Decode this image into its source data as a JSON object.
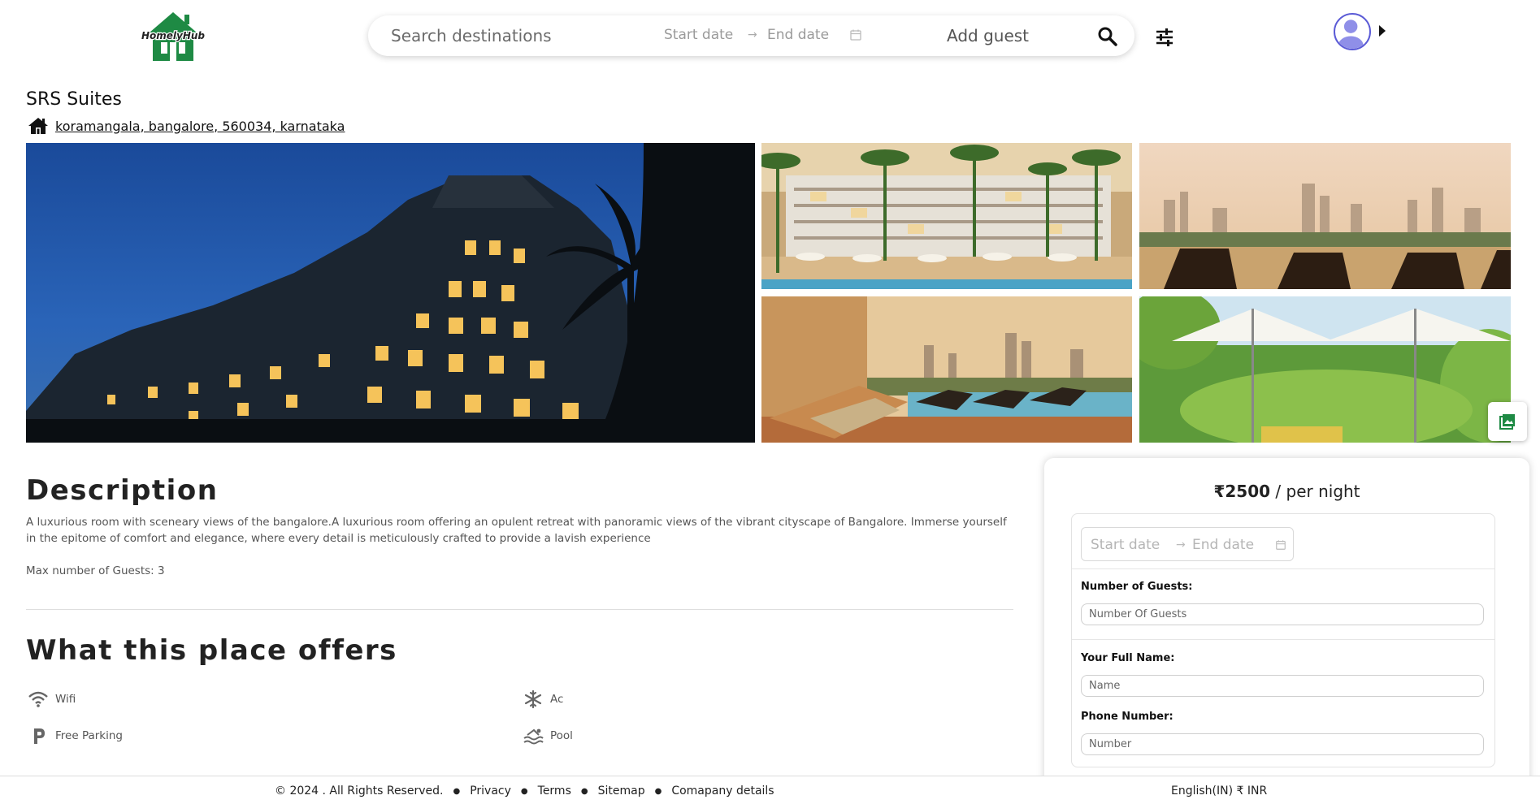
{
  "header": {
    "logo_text": "HomelyHub",
    "search": {
      "destination_placeholder": "Search destinations",
      "start_date_placeholder": "Start date",
      "end_date_placeholder": "End date",
      "guest_placeholder": "Add guest"
    },
    "colors": {
      "logo_green": "#1e8a44",
      "avatar_purple": "#8f8fe8"
    }
  },
  "property": {
    "title": "SRS Suites",
    "address": "koramangala, bangalore, 560034, karnataka"
  },
  "gallery": {
    "images": [
      "hotel-night-exterior",
      "resort-pool-palms",
      "rooftop-loungers-skyline",
      "poolside-deckchair-skyline",
      "garden-umbrellas"
    ],
    "view_all_icon": "gallery-icon"
  },
  "description": {
    "heading": "Description",
    "text": "A luxurious room with sceneary views of the bangalore.A luxurious room offering an opulent retreat with panoramic views of the vibrant cityscape of Bangalore. Immerse yourself in the epitome of comfort and elegance, where every detail is meticulously crafted to provide a lavish experience",
    "max_guests": "Max number of Guests: 3"
  },
  "offers": {
    "heading": "What this place offers",
    "amenities": [
      {
        "label": "Wifi",
        "icon": "wifi-icon"
      },
      {
        "label": "Ac",
        "icon": "snowflake-icon"
      },
      {
        "label": "Free Parking",
        "icon": "parking-icon"
      },
      {
        "label": "Pool",
        "icon": "pool-icon"
      }
    ]
  },
  "booking": {
    "price": "₹2500",
    "per_night": " / per night",
    "start_date_placeholder": "Start date",
    "end_date_placeholder": "End date",
    "guests_label": "Number of Guests:",
    "guests_placeholder": "Number Of Guests",
    "name_label": "Your Full Name:",
    "name_placeholder": "Name",
    "phone_label": "Phone Number:",
    "phone_placeholder": "Number"
  },
  "footer": {
    "copyright": "© 2024 . All Rights Reserved.",
    "links": [
      "Privacy",
      "Terms",
      "Sitemap",
      "Comapany details"
    ],
    "locale": "English(IN)  ₹ INR"
  }
}
